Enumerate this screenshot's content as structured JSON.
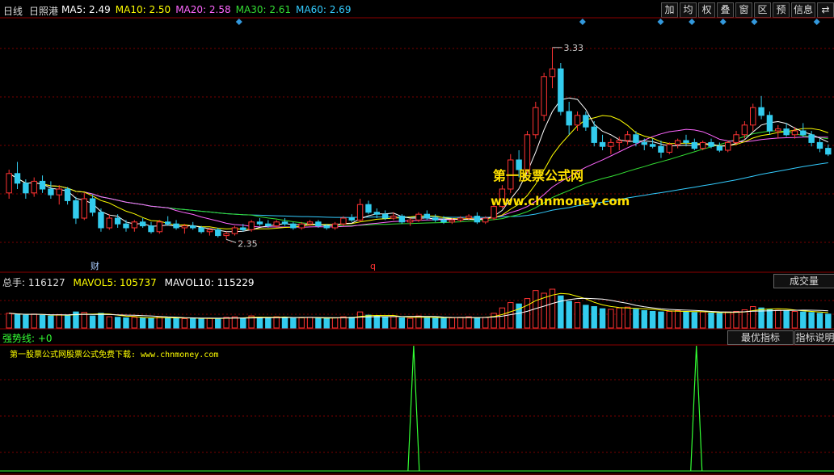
{
  "header": {
    "period": "日线",
    "stock_name": "日照港",
    "ma": [
      {
        "label": "MA5:",
        "value": "2.49",
        "color": "#ffffff"
      },
      {
        "label": "MA10:",
        "value": "2.50",
        "color": "#ffff00"
      },
      {
        "label": "MA20:",
        "value": "2.58",
        "color": "#ff66ff"
      },
      {
        "label": "MA30:",
        "value": "2.61",
        "color": "#33dd33"
      },
      {
        "label": "MA60:",
        "value": "2.69",
        "color": "#33ccff"
      }
    ]
  },
  "toolbar": [
    "加",
    "均",
    "权",
    "叠",
    "窗",
    "区",
    "预",
    "信息",
    "⇄"
  ],
  "price_panel": {
    "high_label": "3.33",
    "low_label": "2.35",
    "marker_cai": "财",
    "marker_q": "q",
    "watermark_1": "第一股票公式网",
    "watermark_2": "www.chnmoney.com"
  },
  "volume_panel": {
    "total_label": "总手:",
    "total_value": "116127",
    "mavol5_label": "MAVOL5:",
    "mavol5_value": "105737",
    "mavol10_label": "MAVOL10:",
    "mavol10_value": "115229",
    "chengjiaoliang_button": "成交量"
  },
  "indicator_panel": {
    "name": "强势线:",
    "value": "+0",
    "best_indicator_button": "最优指标",
    "indicator_desc_button": "指标说明",
    "note": "第一股票公式网股票公式免费下载: www.chnmoney.com"
  },
  "chart_data": {
    "type": "candlestick",
    "price_range": [
      2.2,
      3.45
    ],
    "candles": [
      [
        2.58,
        2.7,
        2.55,
        2.68
      ],
      [
        2.68,
        2.74,
        2.6,
        2.63
      ],
      [
        2.63,
        2.65,
        2.55,
        2.58
      ],
      [
        2.58,
        2.66,
        2.56,
        2.64
      ],
      [
        2.64,
        2.67,
        2.58,
        2.6
      ],
      [
        2.6,
        2.64,
        2.55,
        2.57
      ],
      [
        2.57,
        2.62,
        2.52,
        2.6
      ],
      [
        2.6,
        2.61,
        2.52,
        2.54
      ],
      [
        2.54,
        2.56,
        2.42,
        2.45
      ],
      [
        2.45,
        2.58,
        2.44,
        2.55
      ],
      [
        2.55,
        2.57,
        2.46,
        2.48
      ],
      [
        2.48,
        2.5,
        2.38,
        2.4
      ],
      [
        2.4,
        2.47,
        2.39,
        2.45
      ],
      [
        2.45,
        2.47,
        2.4,
        2.42
      ],
      [
        2.42,
        2.44,
        2.38,
        2.4
      ],
      [
        2.4,
        2.44,
        2.38,
        2.43
      ],
      [
        2.43,
        2.45,
        2.4,
        2.41
      ],
      [
        2.41,
        2.43,
        2.37,
        2.38
      ],
      [
        2.38,
        2.44,
        2.37,
        2.43
      ],
      [
        2.43,
        2.46,
        2.41,
        2.42
      ],
      [
        2.42,
        2.44,
        2.39,
        2.4
      ],
      [
        2.4,
        2.42,
        2.37,
        2.41
      ],
      [
        2.41,
        2.43,
        2.39,
        2.4
      ],
      [
        2.4,
        2.41,
        2.37,
        2.38
      ],
      [
        2.38,
        2.4,
        2.36,
        2.39
      ],
      [
        2.39,
        2.4,
        2.35,
        2.36
      ],
      [
        2.36,
        2.38,
        2.34,
        2.37
      ],
      [
        2.37,
        2.41,
        2.36,
        2.4
      ],
      [
        2.4,
        2.42,
        2.38,
        2.39
      ],
      [
        2.39,
        2.44,
        2.38,
        2.43
      ],
      [
        2.43,
        2.45,
        2.41,
        2.42
      ],
      [
        2.42,
        2.44,
        2.4,
        2.41
      ],
      [
        2.41,
        2.44,
        2.4,
        2.43
      ],
      [
        2.43,
        2.45,
        2.41,
        2.42
      ],
      [
        2.42,
        2.43,
        2.39,
        2.4
      ],
      [
        2.4,
        2.43,
        2.39,
        2.42
      ],
      [
        2.42,
        2.44,
        2.41,
        2.43
      ],
      [
        2.43,
        2.44,
        2.4,
        2.41
      ],
      [
        2.41,
        2.42,
        2.39,
        2.4
      ],
      [
        2.4,
        2.43,
        2.39,
        2.42
      ],
      [
        2.42,
        2.46,
        2.41,
        2.45
      ],
      [
        2.45,
        2.47,
        2.43,
        2.44
      ],
      [
        2.44,
        2.55,
        2.43,
        2.52
      ],
      [
        2.52,
        2.54,
        2.47,
        2.48
      ],
      [
        2.48,
        2.5,
        2.45,
        2.47
      ],
      [
        2.47,
        2.49,
        2.44,
        2.45
      ],
      [
        2.45,
        2.48,
        2.44,
        2.46
      ],
      [
        2.46,
        2.47,
        2.42,
        2.43
      ],
      [
        2.43,
        2.45,
        2.41,
        2.44
      ],
      [
        2.44,
        2.48,
        2.43,
        2.47
      ],
      [
        2.47,
        2.49,
        2.44,
        2.45
      ],
      [
        2.45,
        2.47,
        2.43,
        2.44
      ],
      [
        2.44,
        2.46,
        2.42,
        2.43
      ],
      [
        2.43,
        2.45,
        2.42,
        2.44
      ],
      [
        2.44,
        2.46,
        2.43,
        2.45
      ],
      [
        2.45,
        2.47,
        2.44,
        2.46
      ],
      [
        2.46,
        2.48,
        2.42,
        2.43
      ],
      [
        2.43,
        2.46,
        2.42,
        2.45
      ],
      [
        2.45,
        2.52,
        2.44,
        2.51
      ],
      [
        2.51,
        2.62,
        2.5,
        2.6
      ],
      [
        2.6,
        2.78,
        2.58,
        2.75
      ],
      [
        2.75,
        2.8,
        2.66,
        2.7
      ],
      [
        2.7,
        2.9,
        2.68,
        2.88
      ],
      [
        2.88,
        3.05,
        2.86,
        3.02
      ],
      [
        2.98,
        3.2,
        2.95,
        3.18
      ],
      [
        3.18,
        3.33,
        3.12,
        3.22
      ],
      [
        3.22,
        3.25,
        2.98,
        3.0
      ],
      [
        3.0,
        3.05,
        2.88,
        2.93
      ],
      [
        2.93,
        3.0,
        2.9,
        2.98
      ],
      [
        2.98,
        3.0,
        2.9,
        2.92
      ],
      [
        2.92,
        2.95,
        2.82,
        2.84
      ],
      [
        2.84,
        2.88,
        2.8,
        2.82
      ],
      [
        2.82,
        2.86,
        2.78,
        2.84
      ],
      [
        2.84,
        2.87,
        2.8,
        2.85
      ],
      [
        2.85,
        2.9,
        2.83,
        2.88
      ],
      [
        2.88,
        2.9,
        2.82,
        2.84
      ],
      [
        2.84,
        2.86,
        2.8,
        2.83
      ],
      [
        2.83,
        2.86,
        2.81,
        2.82
      ],
      [
        2.82,
        2.85,
        2.76,
        2.79
      ],
      [
        2.79,
        2.84,
        2.78,
        2.83
      ],
      [
        2.83,
        2.86,
        2.81,
        2.85
      ],
      [
        2.85,
        2.88,
        2.82,
        2.84
      ],
      [
        2.84,
        2.86,
        2.8,
        2.81
      ],
      [
        2.81,
        2.85,
        2.8,
        2.84
      ],
      [
        2.84,
        2.86,
        2.81,
        2.82
      ],
      [
        2.82,
        2.84,
        2.79,
        2.8
      ],
      [
        2.8,
        2.85,
        2.79,
        2.84
      ],
      [
        2.84,
        2.9,
        2.83,
        2.88
      ],
      [
        2.88,
        2.95,
        2.86,
        2.93
      ],
      [
        2.93,
        3.04,
        2.9,
        3.02
      ],
      [
        3.02,
        3.08,
        2.96,
        2.98
      ],
      [
        2.98,
        3.0,
        2.88,
        2.9
      ],
      [
        2.9,
        2.93,
        2.86,
        2.91
      ],
      [
        2.91,
        2.94,
        2.87,
        2.88
      ],
      [
        2.88,
        2.92,
        2.86,
        2.9
      ],
      [
        2.9,
        2.94,
        2.87,
        2.88
      ],
      [
        2.88,
        2.9,
        2.82,
        2.84
      ],
      [
        2.84,
        2.86,
        2.79,
        2.81
      ],
      [
        2.81,
        2.83,
        2.77,
        2.78
      ]
    ],
    "volume": [
      55,
      50,
      48,
      52,
      47,
      45,
      50,
      46,
      60,
      58,
      45,
      55,
      42,
      40,
      38,
      40,
      37,
      36,
      42,
      38,
      36,
      35,
      37,
      34,
      36,
      35,
      40,
      42,
      36,
      45,
      40,
      38,
      42,
      40,
      36,
      38,
      40,
      37,
      35,
      38,
      42,
      40,
      60,
      48,
      44,
      40,
      42,
      38,
      36,
      45,
      40,
      38,
      36,
      38,
      40,
      42,
      38,
      40,
      55,
      75,
      95,
      90,
      110,
      140,
      130,
      145,
      120,
      100,
      95,
      85,
      80,
      72,
      70,
      75,
      78,
      70,
      65,
      62,
      60,
      62,
      65,
      60,
      58,
      60,
      56,
      55,
      60,
      62,
      68,
      80,
      75,
      70,
      66,
      64,
      62,
      60,
      58,
      55,
      52
    ],
    "indicator_spikes": [
      {
        "bar_position": 0.496,
        "value": 1
      },
      {
        "bar_position": 0.835,
        "value": 1
      }
    ]
  }
}
